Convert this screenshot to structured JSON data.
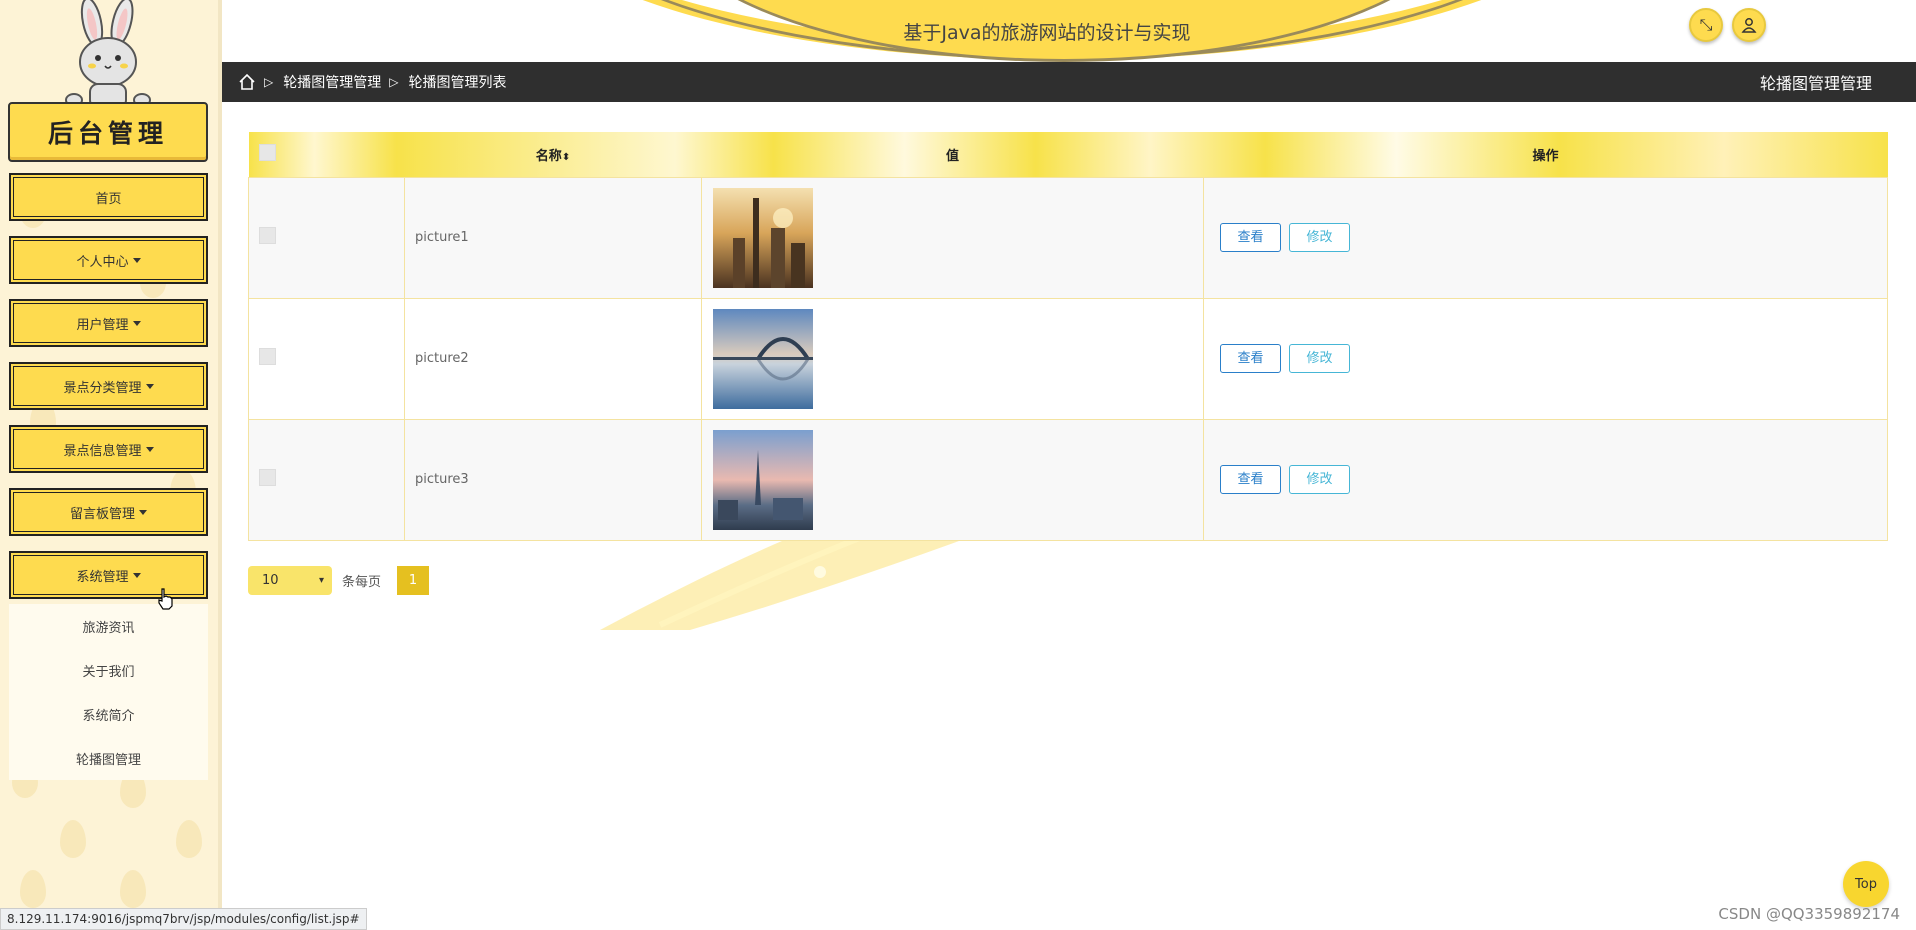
{
  "colors": {
    "accent": "#fedb4f",
    "dark_bar": "#2f2f2f",
    "view_btn": "#2a7fc9",
    "edit_btn": "#46b6d6"
  },
  "sidebar": {
    "brand": "后台管理",
    "items": [
      {
        "label": "首页",
        "has_caret": false
      },
      {
        "label": "个人中心",
        "has_caret": true
      },
      {
        "label": "用户管理",
        "has_caret": true
      },
      {
        "label": "景点分类管理",
        "has_caret": true
      },
      {
        "label": "景点信息管理",
        "has_caret": true
      },
      {
        "label": "留言板管理",
        "has_caret": true
      },
      {
        "label": "系统管理",
        "has_caret": true
      }
    ],
    "submenu": [
      "旅游资讯",
      "关于我们",
      "系统简介",
      "轮播图管理"
    ]
  },
  "header": {
    "title": "基于Java的旅游网站的设计与实现",
    "fullscreen_icon": "fullscreen-icon",
    "user_icon": "user-icon"
  },
  "breadcrumb": {
    "items": [
      "轮播图管理管理",
      "轮播图管理列表"
    ],
    "right_title": "轮播图管理管理"
  },
  "table": {
    "columns": {
      "name": "名称",
      "value": "值",
      "ops": "操作"
    },
    "rows": [
      {
        "name": "picture1",
        "image": "city-sunset-photo",
        "view": "查看",
        "edit": "修改"
      },
      {
        "name": "picture2",
        "image": "bridge-lake-photo",
        "view": "查看",
        "edit": "修改"
      },
      {
        "name": "picture3",
        "image": "city-sky-photo",
        "view": "查看",
        "edit": "修改"
      }
    ]
  },
  "pagination": {
    "page_size": "10",
    "per_page_label": "条每页",
    "current_page": "1"
  },
  "footer": {
    "status_url": "8.129.11.174:9016/jspmq7brv/jsp/modules/config/list.jsp#",
    "top_label": "Top",
    "watermark": "CSDN @QQ3359892174"
  }
}
